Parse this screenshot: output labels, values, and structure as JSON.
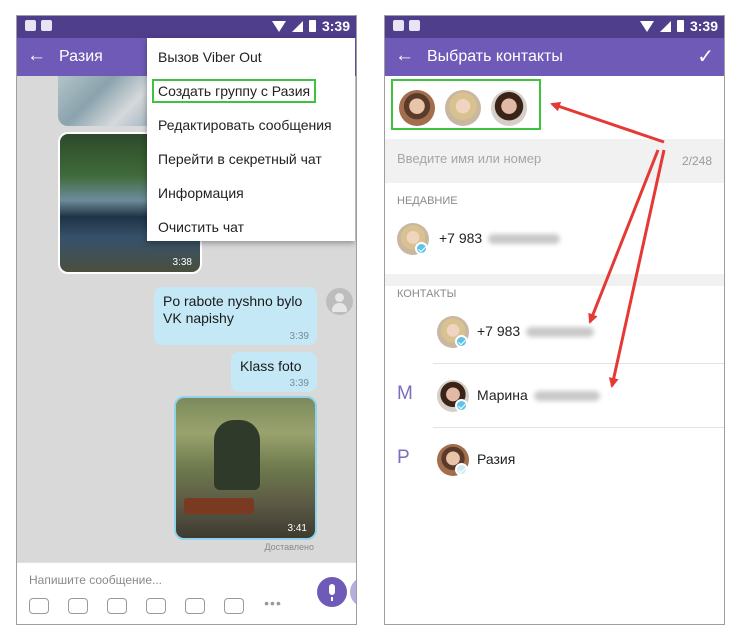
{
  "colors": {
    "header": "#6f5bb7",
    "statusbar": "#4f3e8c",
    "accent": "#7d6cc0",
    "highlight": "#3fc23f",
    "arrow": "#e53935",
    "bubble": "#c4e8f6"
  },
  "left": {
    "statusbar": {
      "time": "3:39"
    },
    "header": {
      "back_icon": "arrow-left-icon",
      "title": "Разия"
    },
    "menu": [
      "Вызов Viber Out",
      "Создать группу с Разия",
      "Редактировать сообщения",
      "Перейти в секретный чат",
      "Информация",
      "Очистить чат"
    ],
    "chat": {
      "photo_time": "3:38",
      "messages": [
        {
          "text": "Po rabote nyshno bylo VK napishy",
          "time": "3:39"
        },
        {
          "text": "Klass foto",
          "time": "3:39"
        }
      ],
      "photo2_time": "3:41",
      "status": "Доставлено"
    },
    "input": {
      "placeholder": "Напишите сообщение...",
      "icons": [
        "sticker-icon",
        "emoji-icon",
        "camera-icon",
        "gif-icon",
        "share-icon",
        "doodle-icon",
        "more-icon"
      ]
    }
  },
  "right": {
    "statusbar": {
      "time": "3:39"
    },
    "header": {
      "title": "Выбрать контакты",
      "confirm_icon": "check-icon"
    },
    "search": {
      "placeholder": "Введите имя или номер",
      "counter": "2/248"
    },
    "sections": {
      "recent": "НЕДАВНИЕ",
      "contacts": "КОНТАКТЫ"
    },
    "recent": [
      {
        "name": "+7 983"
      }
    ],
    "contacts": [
      {
        "letter": "",
        "name": "+7 983"
      },
      {
        "letter": "М",
        "name": "Марина"
      },
      {
        "letter": "Р",
        "name": "Разия"
      }
    ]
  }
}
